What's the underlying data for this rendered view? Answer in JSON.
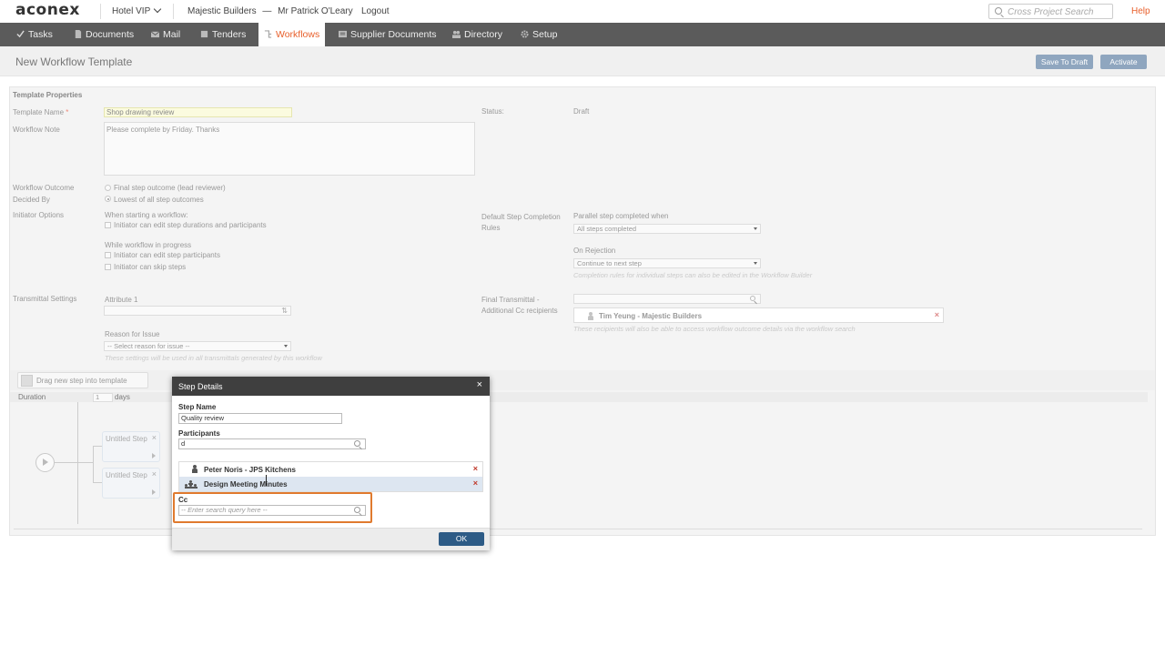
{
  "header": {
    "logo": "aconex",
    "project": "Hotel VIP",
    "organization": "Majestic Builders",
    "separator": "—",
    "user": "Mr Patrick O'Leary",
    "logout": "Logout",
    "search_placeholder": "Cross Project Search",
    "help": "Help"
  },
  "nav": {
    "items": [
      {
        "label": "Tasks",
        "icon": "check-icon"
      },
      {
        "label": "Documents",
        "icon": "document-icon"
      },
      {
        "label": "Mail",
        "icon": "envelope-icon"
      },
      {
        "label": "Tenders",
        "icon": "tender-icon"
      },
      {
        "label": "Workflows",
        "icon": "workflow-icon",
        "active": true
      },
      {
        "label": "Supplier Documents",
        "icon": "supplier-icon"
      },
      {
        "label": "Directory",
        "icon": "people-icon"
      },
      {
        "label": "Setup",
        "icon": "gear-icon"
      }
    ]
  },
  "page": {
    "title": "New Workflow Template",
    "save_draft": "Save To Draft",
    "activate": "Activate"
  },
  "form": {
    "section_title": "Template Properties",
    "template_name_label": "Template Name",
    "required_mark": "*",
    "template_name_value": "Shop drawing review",
    "workflow_note_label": "Workflow Note",
    "workflow_note_value": "Please complete by Friday.  Thanks",
    "status_label": "Status:",
    "status_value": "Draft",
    "outcome_label_1": "Workflow Outcome",
    "outcome_label_2": "Decided By",
    "outcome_option_1": "Final step outcome (lead reviewer)",
    "outcome_option_2": "Lowest of all step outcomes",
    "initiator_label": "Initiator Options",
    "when_starting": "When starting a workflow:",
    "init_opt_1": "Initiator can edit step durations and participants",
    "while_progress": "While workflow in progress",
    "init_opt_2": "Initiator can edit step participants",
    "init_opt_3": "Initiator can skip steps",
    "default_rules_label_1": "Default Step Completion",
    "default_rules_label_2": "Rules",
    "parallel_label": "Parallel step completed when",
    "parallel_value": "All steps completed",
    "on_rejection_label": "On Rejection",
    "on_rejection_value": "Continue to next step",
    "completion_note": "Completion rules for individual steps can also be edited in the Workflow Builder",
    "transmittal_label": "Transmittal Settings",
    "attribute_label": "Attribute 1",
    "reason_label": "Reason for Issue",
    "reason_value": "-- Select reason for issue --",
    "transmittal_note": "These settings will be used in all transmittals generated by this workflow",
    "final_transmittal_label_1": "Final Transmittal -",
    "final_transmittal_label_2": "Additional Cc recipients",
    "cc_recipient": "Tim Yeung - Majestic Builders",
    "recipients_note": "These recipients will also be able to access workflow outcome details via the workflow search"
  },
  "builder": {
    "drag_label": "Drag new step into template",
    "duration_label": "Duration",
    "duration_value": "1",
    "duration_unit": "days",
    "step_1": "Untitled Step",
    "step_2": "Untitled Step"
  },
  "modal": {
    "title": "Step Details",
    "close": "×",
    "step_name_label": "Step Name",
    "step_name_value": "Quality review",
    "participants_label": "Participants",
    "participants_query": "d",
    "participants": [
      {
        "name": "Peter Noris - JPS Kitchens",
        "type": "person-icon"
      },
      {
        "name": "Design Meeting Minutes",
        "type": "group-icon"
      }
    ],
    "remove": "×",
    "cc_label": "Cc",
    "cc_placeholder": "-- Enter search query here --",
    "ok": "OK"
  },
  "colors": {
    "accent": "#e8602c",
    "nav_bg": "#5b5b5b",
    "ok_button": "#2d5b86",
    "highlight": "#e07a2e"
  }
}
